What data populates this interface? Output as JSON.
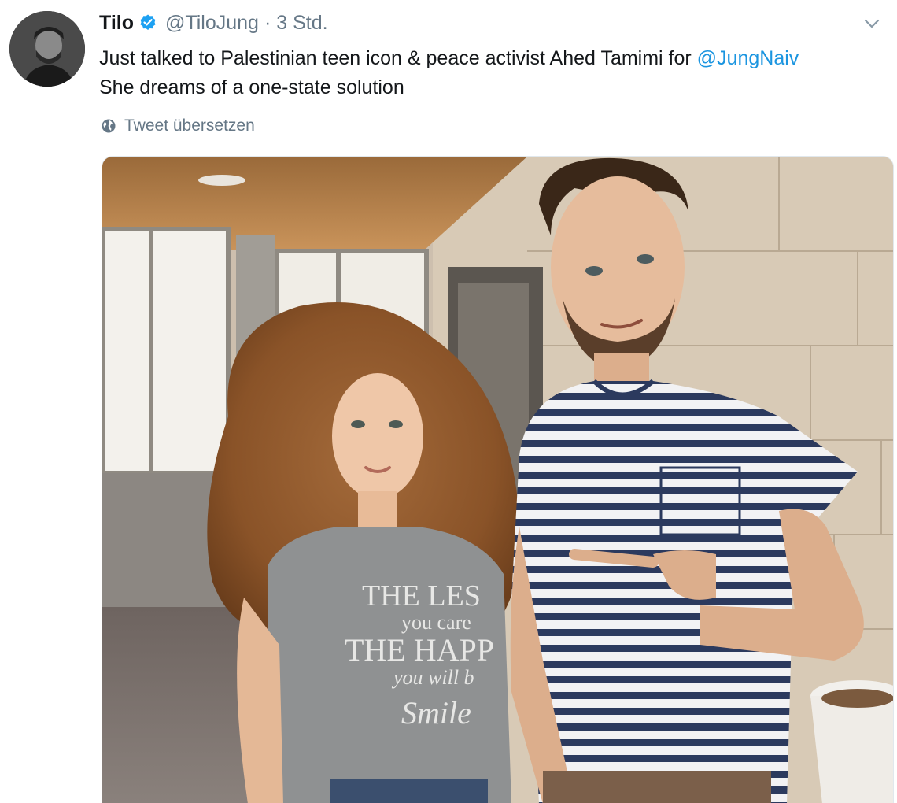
{
  "tweet": {
    "display_name": "Tilo",
    "handle": "@TiloJung",
    "separator": "·",
    "time": "3 Std.",
    "text_line1_before": "Just talked to Palestinian teen icon & peace activist Ahed Tamimi for ",
    "mention": "@JungNaiv",
    "text_line2": "She dreams of a one-state solution",
    "translate_label": "Tweet übersetzen",
    "photo_shirt_text": [
      "THE LES",
      "you care",
      "THE HAPP",
      "you will b",
      "Smile"
    ]
  },
  "icons": {
    "verified": "verified-badge-icon",
    "caret": "chevron-down-icon",
    "globe": "globe-icon"
  },
  "colors": {
    "link": "#1b95e0",
    "secondary_text": "#657786",
    "verified": "#1da1f2"
  }
}
